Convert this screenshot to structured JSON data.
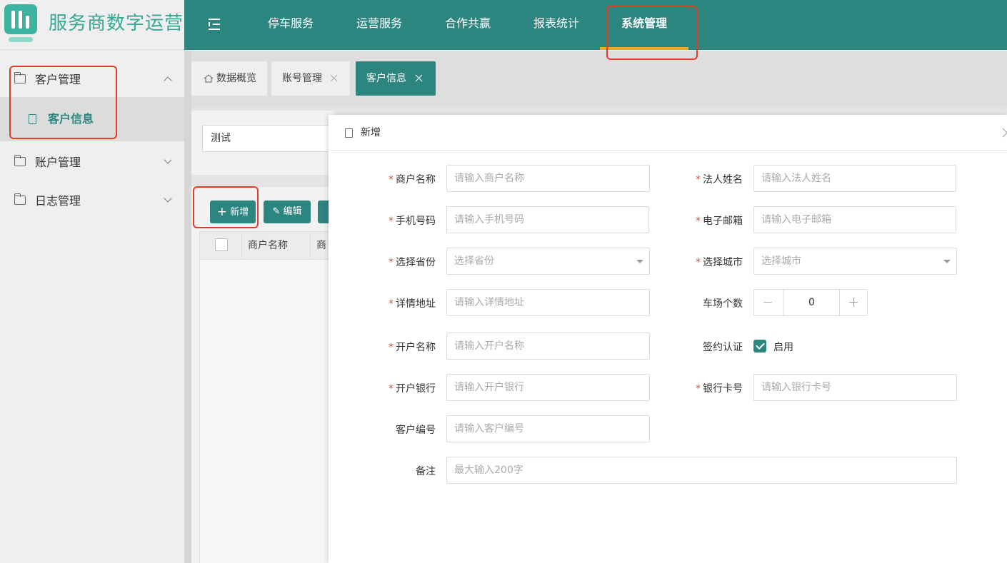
{
  "app": {
    "title": "服务商数字运营"
  },
  "topnav": {
    "items": [
      {
        "label": "停车服务"
      },
      {
        "label": "运营服务"
      },
      {
        "label": "合作共赢"
      },
      {
        "label": "报表统计"
      },
      {
        "label": "系统管理",
        "active": true
      }
    ]
  },
  "sidebar": {
    "groups": [
      {
        "label": "客户管理",
        "expanded": true,
        "children": [
          {
            "label": "客户信息",
            "active": true
          }
        ]
      },
      {
        "label": "账户管理",
        "expanded": false
      },
      {
        "label": "日志管理",
        "expanded": false
      }
    ]
  },
  "tabs": [
    {
      "label": "数据概览",
      "icon": "home-icon"
    },
    {
      "label": "账号管理",
      "closable": true
    },
    {
      "label": "客户信息",
      "closable": true,
      "active": true
    }
  ],
  "search": {
    "value": "测试"
  },
  "toolbar": {
    "add_label": "新增",
    "edit_label": "编辑"
  },
  "table": {
    "columns": [
      "商户名称",
      "商"
    ]
  },
  "modal": {
    "title": "新增",
    "fields": {
      "merchant_name": {
        "label": "商户名称",
        "placeholder": "请输入商户名称",
        "required": true
      },
      "legal_name": {
        "label": "法人姓名",
        "placeholder": "请输入法人姓名",
        "required": true
      },
      "phone": {
        "label": "手机号码",
        "placeholder": "请输入手机号码",
        "required": true
      },
      "email": {
        "label": "电子邮箱",
        "placeholder": "请输入电子邮箱",
        "required": true
      },
      "province": {
        "label": "选择省份",
        "placeholder": "选择省份",
        "required": true
      },
      "city": {
        "label": "选择城市",
        "placeholder": "选择城市",
        "required": true
      },
      "address": {
        "label": "详情地址",
        "placeholder": "请输入详情地址",
        "required": true
      },
      "lot_count": {
        "label": "车场个数",
        "value": "0"
      },
      "account_name": {
        "label": "开户名称",
        "placeholder": "请输入开户名称",
        "required": true
      },
      "sign_auth": {
        "label": "签约认证",
        "checkbox_label": "启用",
        "checked": true
      },
      "bank": {
        "label": "开户银行",
        "placeholder": "请输入开户银行",
        "required": true
      },
      "card_no": {
        "label": "银行卡号",
        "placeholder": "请输入银行卡号",
        "required": true
      },
      "customer_no": {
        "label": "客户编号",
        "placeholder": "请输入客户编号"
      },
      "remark": {
        "label": "备注",
        "placeholder": "最大输入200字"
      }
    }
  },
  "colors": {
    "primary": "#2d8580",
    "accent": "#f0a81c",
    "logo": "#36a894",
    "required": "#e2492c",
    "annotation": "#e23c28"
  }
}
